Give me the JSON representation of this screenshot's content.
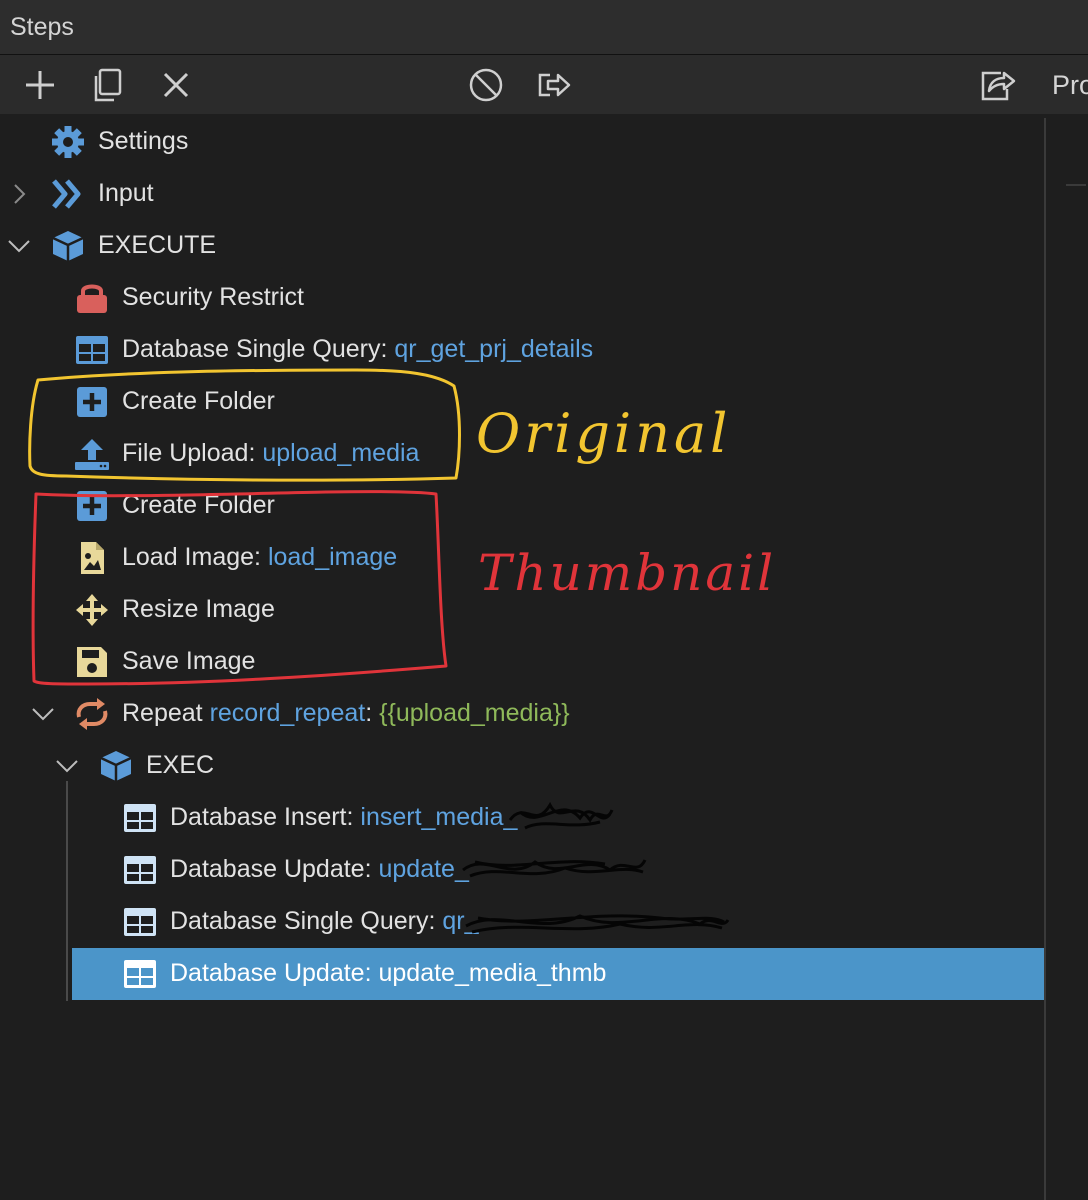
{
  "window": {
    "title": "Steps"
  },
  "toolbar": {
    "buttons": [
      {
        "name": "add-step-button",
        "icon": "plus-icon"
      },
      {
        "name": "duplicate-step-button",
        "icon": "copy-icon"
      },
      {
        "name": "delete-step-button",
        "icon": "close-icon"
      },
      {
        "name": "disable-step-button",
        "icon": "prohibited-icon"
      },
      {
        "name": "move-step-button",
        "icon": "export-arrow-icon"
      },
      {
        "name": "share-step-button",
        "icon": "share-icon"
      }
    ],
    "right_label": "Pro"
  },
  "colors": {
    "background": "#1e1e1e",
    "accent_text": "#5fa3e0",
    "input_text": "#8fb95a",
    "selection": "#4b95c9",
    "annotation_yellow": "#f2c530",
    "annotation_red": "#e0343a"
  },
  "tree": {
    "settings": {
      "label": "Settings",
      "icon": "gear-icon"
    },
    "input": {
      "label": "Input",
      "icon": "double-chevron-icon",
      "expanded": false
    },
    "execute": {
      "label": "EXECUTE",
      "icon": "cube-icon",
      "expanded": true
    },
    "security_restrict": {
      "label": "Security Restrict",
      "icon": "lock-icon"
    },
    "db_single_query": {
      "prefix": "Database Single Query: ",
      "value": "qr_get_prj_details",
      "icon": "table-icon"
    },
    "create_folder_1": {
      "label": "Create Folder",
      "icon": "plus-square-icon"
    },
    "file_upload": {
      "prefix": "File Upload: ",
      "value": "upload_media",
      "icon": "upload-icon"
    },
    "create_folder_2": {
      "label": "Create Folder",
      "icon": "plus-square-icon"
    },
    "load_image": {
      "prefix": "Load Image: ",
      "value": "load_image",
      "icon": "image-file-icon"
    },
    "resize_image": {
      "label": "Resize Image",
      "icon": "move-arrows-icon"
    },
    "save_image": {
      "label": "Save Image",
      "icon": "floppy-icon"
    },
    "repeat": {
      "prefix": "Repeat ",
      "name": "record_repeat",
      "sep": ": ",
      "expr": "{{upload_media}}",
      "icon": "repeat-icon",
      "expanded": true
    },
    "exec": {
      "label": "EXEC",
      "icon": "cube-icon",
      "expanded": true
    },
    "db_insert": {
      "prefix": "Database Insert: ",
      "value": "insert_media_",
      "icon": "table-icon"
    },
    "db_update_1": {
      "prefix": "Database Update: ",
      "value": "update_",
      "icon": "table-icon"
    },
    "db_single_query_2": {
      "prefix": "Database Single Query: ",
      "value": "qr_",
      "icon": "table-icon"
    },
    "db_update_2": {
      "prefix": "Database Update: ",
      "value": "update_media_thmb",
      "icon": "table-icon",
      "selected": true
    }
  },
  "annotations": {
    "original": "Original",
    "thumbnail": "Thumbnail"
  }
}
